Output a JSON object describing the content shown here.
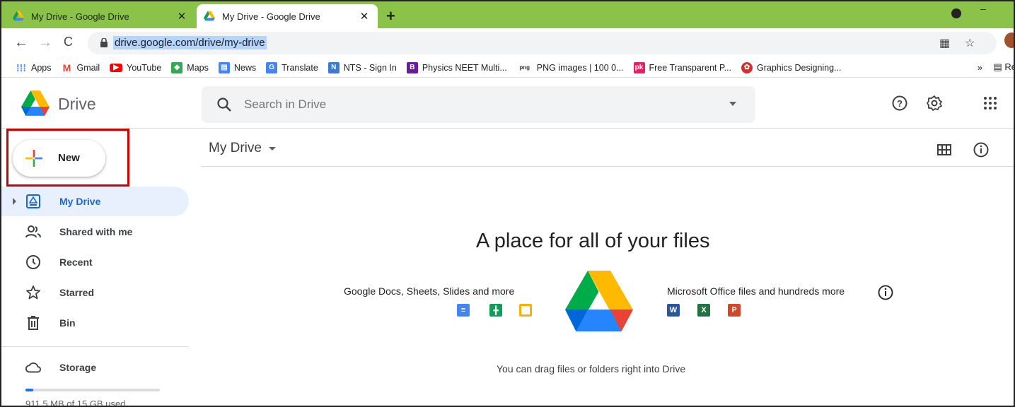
{
  "browser": {
    "tabs": [
      {
        "title": "My Drive - Google Drive",
        "active": false
      },
      {
        "title": "My Drive - Google Drive",
        "active": true
      }
    ],
    "url": "drive.google.com/drive/my-drive",
    "bookmarks": [
      {
        "label": "Apps",
        "icon": "apps-grid-icon",
        "color": "#4285f4"
      },
      {
        "label": "Gmail",
        "icon": "gmail-icon",
        "color": "#ea4335"
      },
      {
        "label": "YouTube",
        "icon": "youtube-icon",
        "color": "#ff0000"
      },
      {
        "label": "Maps",
        "icon": "maps-icon",
        "color": "#34a853"
      },
      {
        "label": "News",
        "icon": "news-icon",
        "color": "#4285f4"
      },
      {
        "label": "Translate",
        "icon": "translate-icon",
        "color": "#4285f4"
      },
      {
        "label": "NTS - Sign In",
        "icon": "nts-icon",
        "color": "#3a7bd5"
      },
      {
        "label": "Physics NEET Multi...",
        "icon": "byjus-icon",
        "color": "#6a1b9a"
      },
      {
        "label": "PNG images | 100 0...",
        "icon": "png-icon",
        "color": "#333333"
      },
      {
        "label": "Free Transparent P...",
        "icon": "pk-icon",
        "color": "#e91e63"
      },
      {
        "label": "Graphics Designing...",
        "icon": "graphics-icon",
        "color": "#d32f2f"
      }
    ],
    "bookmarks_overflow": "»",
    "reading_list": "Re"
  },
  "drive": {
    "app_name": "Drive",
    "search": {
      "placeholder": "Search in Drive"
    },
    "new_button": "New",
    "nav": [
      {
        "label": "My Drive",
        "icon": "my-drive-icon",
        "selected": true
      },
      {
        "label": "Shared with me",
        "icon": "shared-icon",
        "selected": false
      },
      {
        "label": "Recent",
        "icon": "clock-icon",
        "selected": false
      },
      {
        "label": "Starred",
        "icon": "star-icon",
        "selected": false
      },
      {
        "label": "Bin",
        "icon": "trash-icon",
        "selected": false
      }
    ],
    "storage": {
      "label": "Storage",
      "used_text": "911.5 MB of 15 GB used",
      "fraction_used": 0.06
    },
    "content": {
      "title": "My Drive",
      "empty_headline": "A place for all of your files",
      "promo_left": "Google Docs, Sheets, Slides and more",
      "promo_right": "Microsoft Office files and hundreds more",
      "drag_hint": "You can drag files or folders right into Drive",
      "google_file_icons": [
        {
          "name": "docs-icon",
          "color": "#4285f4"
        },
        {
          "name": "sheets-icon",
          "color": "#0f9d58"
        },
        {
          "name": "slides-icon",
          "color": "#f4b400"
        }
      ],
      "office_file_icons": [
        {
          "name": "word-icon",
          "letter": "W",
          "color": "#2b579a"
        },
        {
          "name": "excel-icon",
          "letter": "X",
          "color": "#217346"
        },
        {
          "name": "powerpoint-icon",
          "letter": "P",
          "color": "#d24726"
        }
      ]
    }
  }
}
